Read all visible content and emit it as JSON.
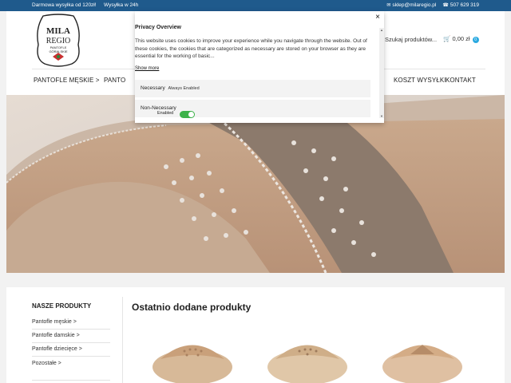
{
  "topbar": {
    "free_shipping": "Darmowa wysyłka od 120zł!",
    "shipping_24h": "Wysyłka w 24h",
    "email": "sklep@milaregio.pl",
    "phone": "507 629 319",
    "email_icon": "envelope-icon",
    "phone_icon": "phone-icon"
  },
  "logo": {
    "line1": "MILA",
    "line2": "REGIO",
    "line3": "PANTOFLE",
    "line4": "GÓRALSKIE"
  },
  "header": {
    "search_label": "Szukaj produktów...",
    "cart_total": "0,00 zł",
    "cart_count": "0"
  },
  "nav": {
    "items": [
      "PANTOFLE MĘSKIE >",
      "PANTO",
      "KOSZT WYSYŁKI",
      "KONTAKT"
    ]
  },
  "sidebar": {
    "title": "NASZE PRODUKTY",
    "items": [
      "Pantofle męskie >",
      "Pantofle damskie >",
      "Pantofle dziecięce >",
      "Pozostałe >"
    ]
  },
  "main": {
    "title": "Ostatnio dodane produkty"
  },
  "modal": {
    "title": "Privacy Overview",
    "text": "This website uses cookies to improve your experience while you navigate through the website. Out of these cookies, the cookies that are categorized as necessary are stored on your browser as they are essential for the working of basic...",
    "show_more": "Show more",
    "necessary_label": "Necessary",
    "necessary_status": "Always Enabled",
    "non_necessary_label": "Non-Necessary",
    "non_necessary_status": "Enabled",
    "close_symbol": "×"
  },
  "colors": {
    "topbar": "#1f5a8c",
    "badge": "#2aa9e0",
    "toggle_on": "#3db24a"
  }
}
